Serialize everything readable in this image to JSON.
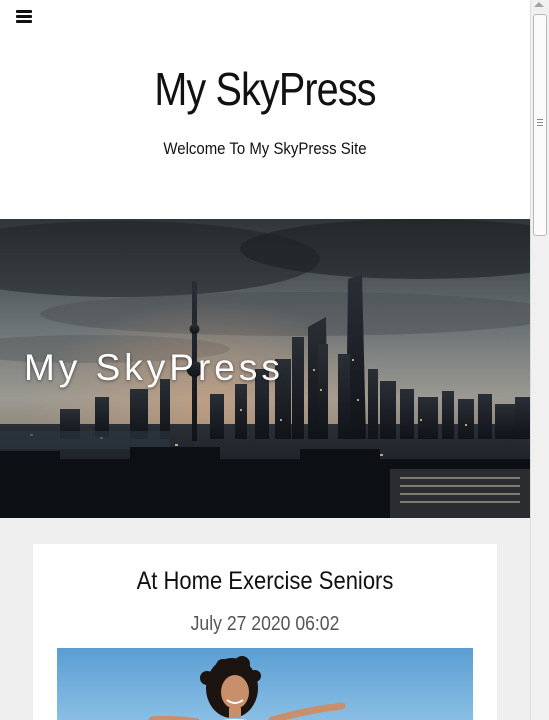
{
  "site": {
    "title": "My SkyPress",
    "description": "Welcome To My SkyPress Site"
  },
  "header": {
    "menu_icon": "hamburger-menu-icon"
  },
  "hero": {
    "title": "My SkyPress"
  },
  "posts": [
    {
      "title": "At Home Exercise Seniors",
      "date": "July 27 2020 06:02"
    }
  ]
}
